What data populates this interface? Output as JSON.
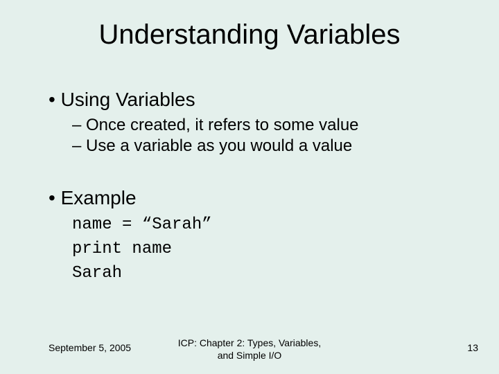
{
  "title": "Understanding Variables",
  "bullets": {
    "using": {
      "label": "Using Variables",
      "sub": [
        "Once created, it refers to some value",
        "Use a variable as you would a value"
      ]
    },
    "example": {
      "label": "Example",
      "code": [
        "name = “Sarah”",
        "print name",
        "Sarah"
      ]
    }
  },
  "footer": {
    "date": "September 5,  2005",
    "center_line1": "ICP: Chapter 2: Types, Variables,",
    "center_line2": "and Simple I/O",
    "page": "13"
  }
}
